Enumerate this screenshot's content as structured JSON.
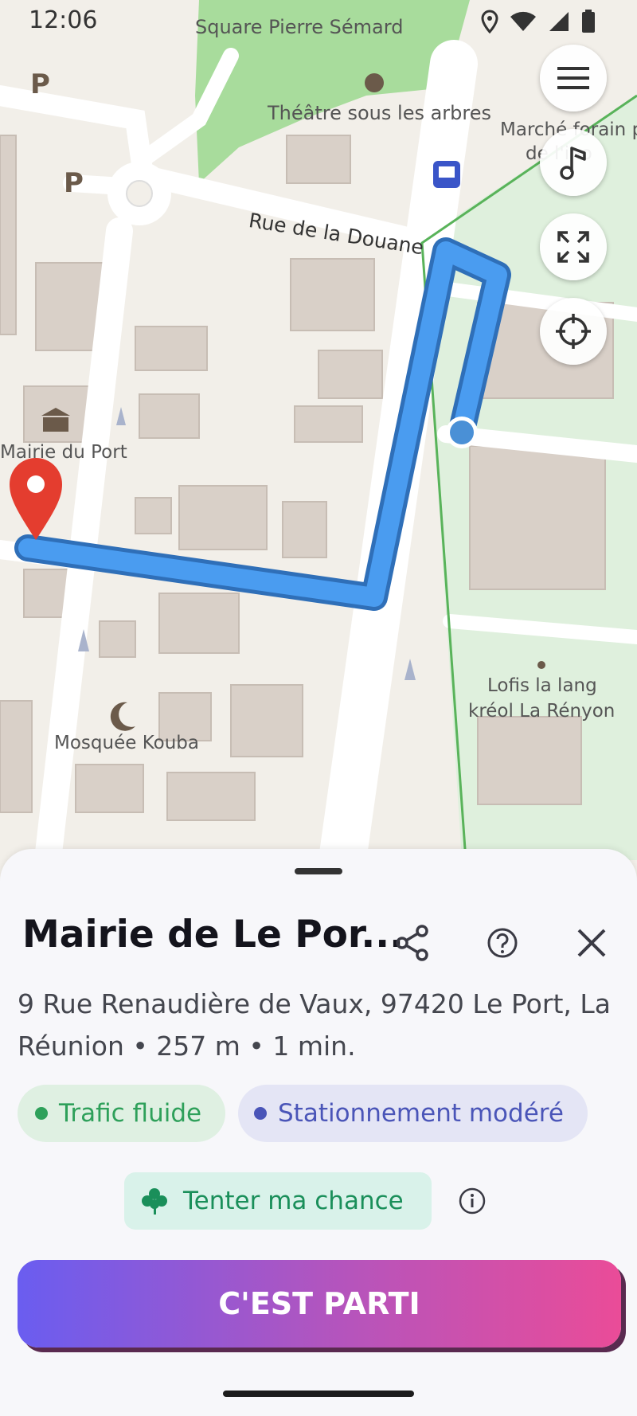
{
  "status_bar": {
    "time": "12:06"
  },
  "map": {
    "labels": {
      "square": "Square Pierre Sémard",
      "theatre": "Théâtre sous les arbres",
      "marche": "Marché forain p",
      "marche2": "de l'ino",
      "rue": "Rue de la Douane",
      "mairie": "Mairie du Port",
      "mosquee": "Mosquée Kouba",
      "lofis1": "Lofis la lang",
      "lofis2": "kréol La Rényon",
      "parking": "P"
    }
  },
  "place": {
    "title": "Mairie de Le Por...",
    "address": "9 Rue Renaudière de Vaux, 97420 Le Port, La Réunion  •  257 m  •  1 min."
  },
  "chips": {
    "traffic": "Trafic fluide",
    "parking": "Stationnement modéré"
  },
  "luck_button": "Tenter ma chance",
  "go_button": "C'EST PARTI",
  "colors": {
    "route": "#4a9cf0",
    "route_outline": "#2f6fb8",
    "marker": "#e43d2f",
    "traffic_green": "#2ea05a",
    "parking_blue": "#4a55b8",
    "gradient_start": "#6a5df0",
    "gradient_end": "#ea4c98"
  }
}
